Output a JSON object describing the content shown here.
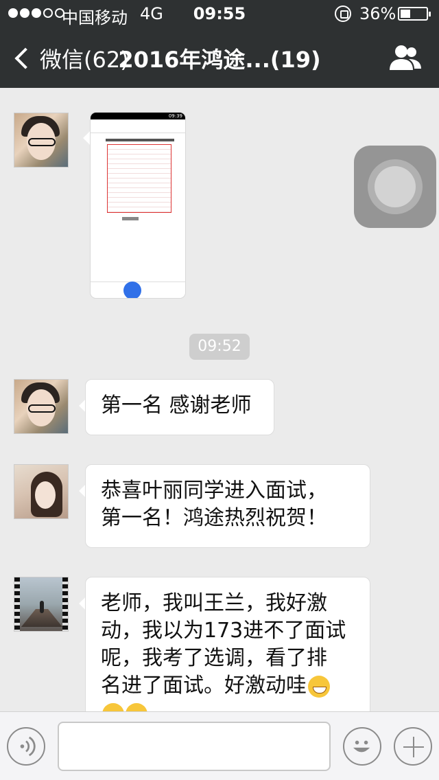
{
  "status_bar": {
    "carrier": "中国移动",
    "network": "4G",
    "time": "09:55",
    "battery": "36%"
  },
  "nav": {
    "back_label": "微信(62)",
    "title": "2016年鸿途...(19)",
    "members_icon": "group-members-icon"
  },
  "image_message": {
    "phone_status_time": "09:39"
  },
  "time_divider": "09:52",
  "messages": [
    {
      "lines": [
        "第一名 感谢老师"
      ]
    },
    {
      "lines": [
        "恭喜叶丽同学进入面试，",
        "第一名！鸿途热烈祝贺！"
      ]
    },
    {
      "lines": [
        "老师，我叫王兰，我好激",
        "动，我以为173进不了面试",
        "呢，我考了选调，看了排",
        "名进了面试。好激动哇"
      ]
    }
  ],
  "input_bar": {
    "voice_icon": "voice-input-icon",
    "emoji_icon": "emoji-icon",
    "plus_icon": "plus-icon"
  },
  "colors": {
    "nav_bg": "#2e3132",
    "chat_bg": "#ebebeb",
    "time_chip": "#cecece"
  }
}
